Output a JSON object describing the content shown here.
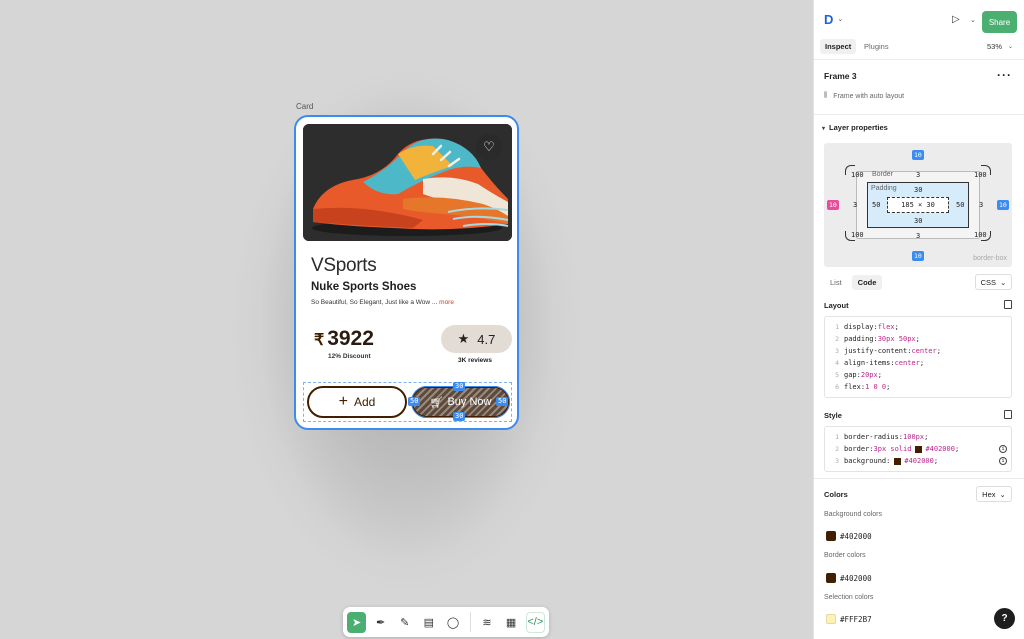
{
  "canvas": {
    "frame_label": "Card",
    "card": {
      "brand": "VSports",
      "product_name": "Nuke Sports Shoes",
      "description": "So Beautiful, So Elegant, Just like a Wow ...",
      "more_link": "more",
      "currency": "₹",
      "price": "3922",
      "discount": "12% Discount",
      "rating": "4.7",
      "reviews": "3K reviews",
      "add_label": "Add",
      "buy_label": "Buy Now",
      "selection_chips": {
        "top": "30",
        "bottom": "30",
        "left": "50",
        "right": "50"
      }
    },
    "toolbar": {
      "tools": [
        "move-tool",
        "pen-tool",
        "pencil-tool",
        "text-tool",
        "comment-tool",
        "dev-mode-tool",
        "inspect-tool",
        "code-tool"
      ]
    }
  },
  "panel": {
    "logo": "D",
    "share_label": "Share",
    "tabs": [
      "Inspect",
      "Plugins"
    ],
    "active_tab": "Inspect",
    "zoom": "53%",
    "frame_title": "Frame 3",
    "frame_subtitle": "Frame with auto layout",
    "layer_properties_title": "Layer properties",
    "box_model": {
      "outer_top": "10",
      "outer_bottom": "10",
      "outer_left": "10",
      "outer_right": "10",
      "corner_tl": "100",
      "corner_tr": "100",
      "corner_bl": "100",
      "corner_br": "100",
      "border_label": "Border",
      "border_top": "3",
      "border_bottom": "3",
      "border_left": "3",
      "border_right": "3",
      "padding_label": "Padding",
      "padding_top": "30",
      "padding_bottom": "30",
      "padding_left": "50",
      "padding_right": "50",
      "content_size": "185 × 30",
      "box_sizing": "border-box"
    },
    "list_code_tabs": [
      "List",
      "Code"
    ],
    "active_list_code": "Code",
    "lang_select": "CSS",
    "layout_title": "Layout",
    "layout_code": [
      {
        "n": "1",
        "prop": "display: ",
        "val": "flex",
        "end": ";"
      },
      {
        "n": "2",
        "prop": "padding: ",
        "val": "30px 50px",
        "end": ";"
      },
      {
        "n": "3",
        "prop": "justify-content: ",
        "val": "center",
        "end": ";"
      },
      {
        "n": "4",
        "prop": "align-items: ",
        "val": "center",
        "end": ";"
      },
      {
        "n": "5",
        "prop": "gap: ",
        "val": "20px",
        "end": ";"
      },
      {
        "n": "6",
        "prop": "flex: ",
        "val": "1 0 0",
        "end": ";"
      }
    ],
    "style_title": "Style",
    "style_code": [
      {
        "n": "1",
        "prop": "border-radius: ",
        "val": "100px",
        "end": ";",
        "swatch": false,
        "info": false
      },
      {
        "n": "2",
        "prop": "border: ",
        "val": "3px solid",
        "val2": "#402000",
        "end": ";",
        "swatch": true,
        "info": true
      },
      {
        "n": "3",
        "prop": "background: ",
        "val": "",
        "val2": "#402000",
        "end": ";",
        "swatch": true,
        "info": true
      }
    ],
    "colors_title": "Colors",
    "color_format": "Hex",
    "background_colors_label": "Background colors",
    "background_color": "#402000",
    "border_colors_label": "Border colors",
    "border_color": "#402000",
    "selection_colors_label": "Selection colors",
    "selection_color": "#FFF2B7",
    "help_label": "?"
  },
  "colors": {
    "accent_blue": "#3b8cf0",
    "share_green": "#4caf72",
    "brand_brown": "#402000",
    "selection_cream": "#FFF2B7"
  }
}
